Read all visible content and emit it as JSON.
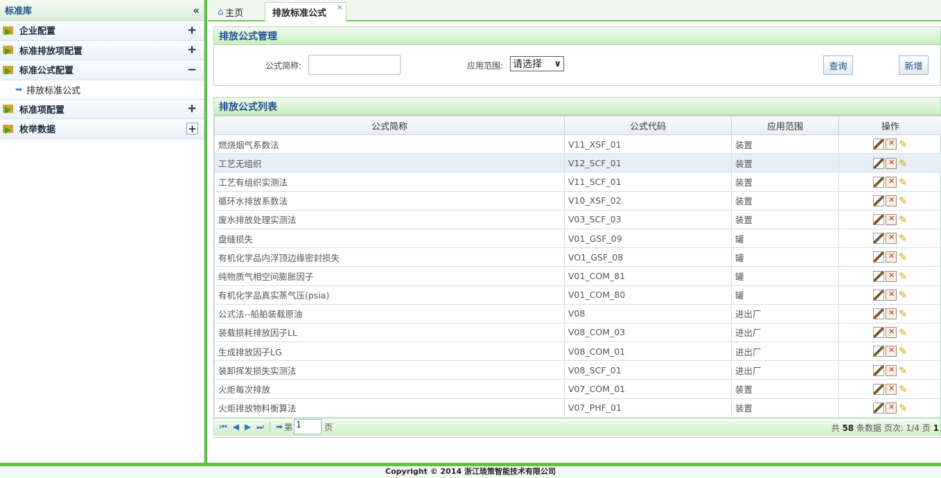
{
  "sidebar": {
    "title": "标准库",
    "collapse_icon": "«",
    "items": [
      {
        "label": "企业配置",
        "toggle": "+"
      },
      {
        "label": "标准排放项配置",
        "toggle": "+"
      },
      {
        "label": "标准公式配置",
        "toggle": "−"
      },
      {
        "label": "标准项配置",
        "toggle": "+"
      },
      {
        "label": "枚举数据",
        "toggle": "+"
      }
    ],
    "sub_item": {
      "label": "排放标准公式"
    }
  },
  "tabs": {
    "home": "主页",
    "active": "排放标准公式",
    "close": "×"
  },
  "search": {
    "title": "排放公式管理",
    "name_label": "公式简称:",
    "scope_label": "应用范围:",
    "scope_value": "请选择",
    "query_button": "查询",
    "add_button": "新增"
  },
  "list": {
    "title": "排放公式列表",
    "columns": [
      "公式简称",
      "公式代码",
      "应用范围",
      "操作"
    ],
    "rows": [
      {
        "name": "燃烧烟气系数法",
        "code": "V11_XSF_01",
        "scope": "装置"
      },
      {
        "name": "工艺无组织",
        "code": "V12_SCF_01",
        "scope": "装置"
      },
      {
        "name": "工艺有组织实测法",
        "code": "V11_SCF_01",
        "scope": "装置"
      },
      {
        "name": "循环水排放系数法",
        "code": "V10_XSF_02",
        "scope": "装置"
      },
      {
        "name": "废水排放处理实测法",
        "code": "V03_SCF_03",
        "scope": "装置"
      },
      {
        "name": "盘缝损失",
        "code": "V01_GSF_09",
        "scope": "罐"
      },
      {
        "name": "有机化学品内浮顶边缘密封损失",
        "code": "VO1_GSF_08",
        "scope": "罐"
      },
      {
        "name": "纯物质气相空间膨胀因子",
        "code": "V01_COM_81",
        "scope": "罐"
      },
      {
        "name": "有机化学品真实蒸气压(psia)",
        "code": "V01_COM_80",
        "scope": "罐"
      },
      {
        "name": "公式法--船舶装载原油",
        "code": "V08",
        "scope": "进出厂"
      },
      {
        "name": "装载损耗排放因子LL",
        "code": "V08_COM_03",
        "scope": "进出厂"
      },
      {
        "name": "生成排放因子LG",
        "code": "V08_COM_01",
        "scope": "进出厂"
      },
      {
        "name": "装卸挥发损失实测法",
        "code": "V08_SCF_01",
        "scope": "进出厂"
      },
      {
        "name": "火炬每次排放",
        "code": "V07_COM_01",
        "scope": "装置"
      },
      {
        "name": "火炬排放物料衡算法",
        "code": "V07_PHF_01",
        "scope": "装置"
      }
    ]
  },
  "pager": {
    "page_prefix": "第",
    "page_value": "1",
    "page_suffix": "页",
    "total_prefix": "共",
    "total_count": "58",
    "total_suffix": "条数据 页次:",
    "page_info": "1/4 页",
    "trailing": "1"
  },
  "footer": {
    "text": "Copyright © 2014 浙江琰策智能技术有限公司"
  }
}
